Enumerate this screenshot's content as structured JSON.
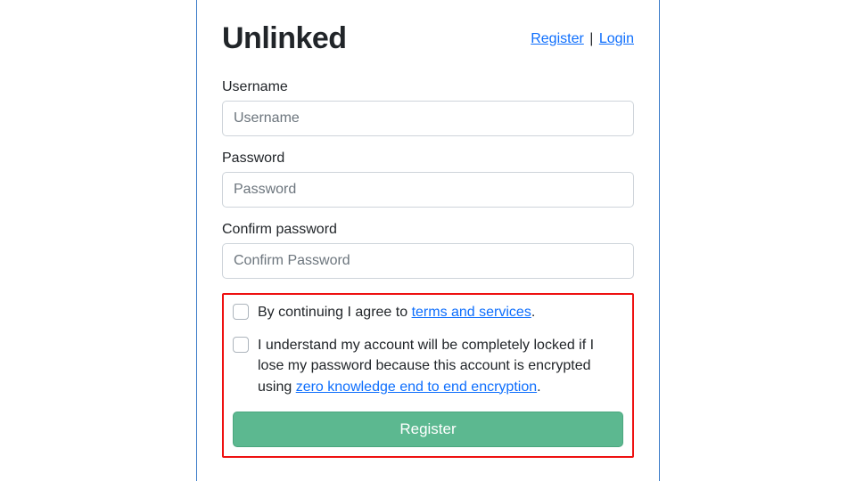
{
  "header": {
    "brand": "Unlinked",
    "register_link": "Register",
    "login_link": "Login",
    "separator": " | "
  },
  "form": {
    "username": {
      "label": "Username",
      "placeholder": "Username"
    },
    "password": {
      "label": "Password",
      "placeholder": "Password"
    },
    "confirm": {
      "label": "Confirm password",
      "placeholder": "Confirm Password"
    },
    "terms": {
      "prefix": "By continuing I agree to ",
      "link": "terms and services",
      "suffix": "."
    },
    "encryption": {
      "prefix": "I understand my account will be completely locked if I lose my password because this account is encrypted using ",
      "link": "zero knowledge end to end encryption",
      "suffix": "."
    },
    "submit_label": "Register"
  }
}
